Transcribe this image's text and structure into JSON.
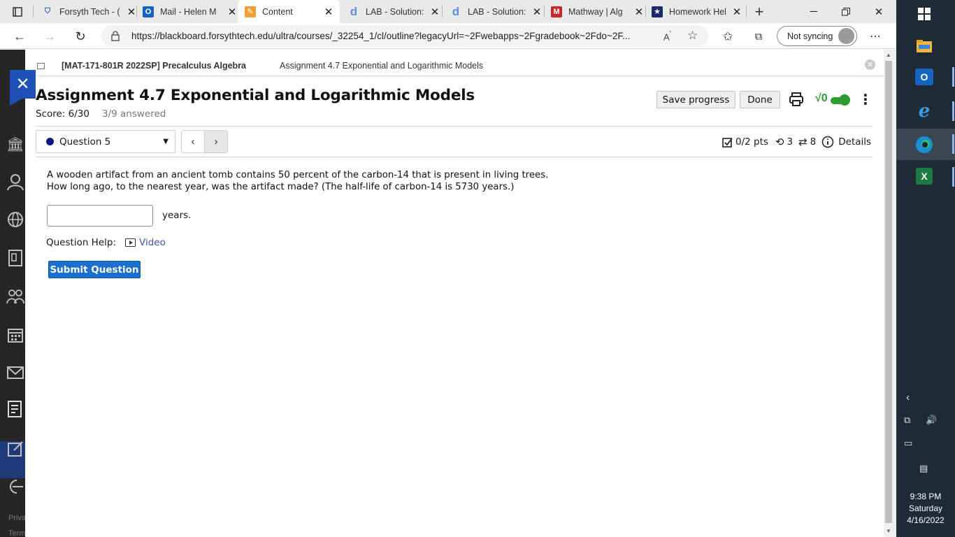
{
  "browser": {
    "tabs": [
      {
        "label": "Forsyth Tech - (",
        "icon": "shield-icon",
        "active": false
      },
      {
        "label": "Mail - Helen M",
        "icon": "outlook-icon",
        "active": false
      },
      {
        "label": "Content",
        "icon": "pencil-icon",
        "active": true
      },
      {
        "label": "LAB - Solution:",
        "icon": "d-icon",
        "active": false
      },
      {
        "label": "LAB - Solution:",
        "icon": "d-icon",
        "active": false
      },
      {
        "label": "Mathway | Alg",
        "icon": "mathway-icon",
        "active": false
      },
      {
        "label": "Homework Hel",
        "icon": "star-badge-icon",
        "active": false
      }
    ],
    "url": "https://blackboard.forsythtech.edu/ultra/courses/_32254_1/cl/outline?legacyUrl=~2Fwebapps~2Fgradebook~2Fdo~2F...",
    "sync_label": "Not syncing"
  },
  "sidebar": {
    "footer_1": "Priva",
    "footer_2": "Term"
  },
  "breadcrumb": {
    "course": "[MAT-171-801R 2022SP] Precalculus Algebra",
    "page": "Assignment 4.7 Exponential and Logarithmic Models"
  },
  "assignment": {
    "title": "Assignment 4.7 Exponential and Logarithmic Models",
    "score_label": "Score: 6/30",
    "answered": "3/9 answered",
    "save_label": "Save progress",
    "done_label": "Done",
    "sqrt_label": "√0"
  },
  "question": {
    "selector_label": "Question 5",
    "points": "0/2 pts",
    "retries": "3",
    "attempts": "8",
    "details_label": "Details",
    "line1": "A wooden artifact from an ancient tomb contains 50 percent of the carbon-14 that is present in living trees.",
    "line2": "How long ago, to the nearest year, was the artifact made? (The half-life of carbon-14 is 5730 years.)",
    "input_value": "",
    "unit": "years.",
    "help_label": "Question Help:",
    "video_label": "Video",
    "submit_label": "Submit Question"
  },
  "taskbar": {
    "time": "9:38 PM",
    "day": "Saturday",
    "date": "4/16/2022"
  },
  "colors": {
    "accent": "#1a6fcf",
    "toggle_green": "#2d9b2d",
    "question_dot": "#0d1a7a",
    "panel_close": "#1f4fb8"
  }
}
